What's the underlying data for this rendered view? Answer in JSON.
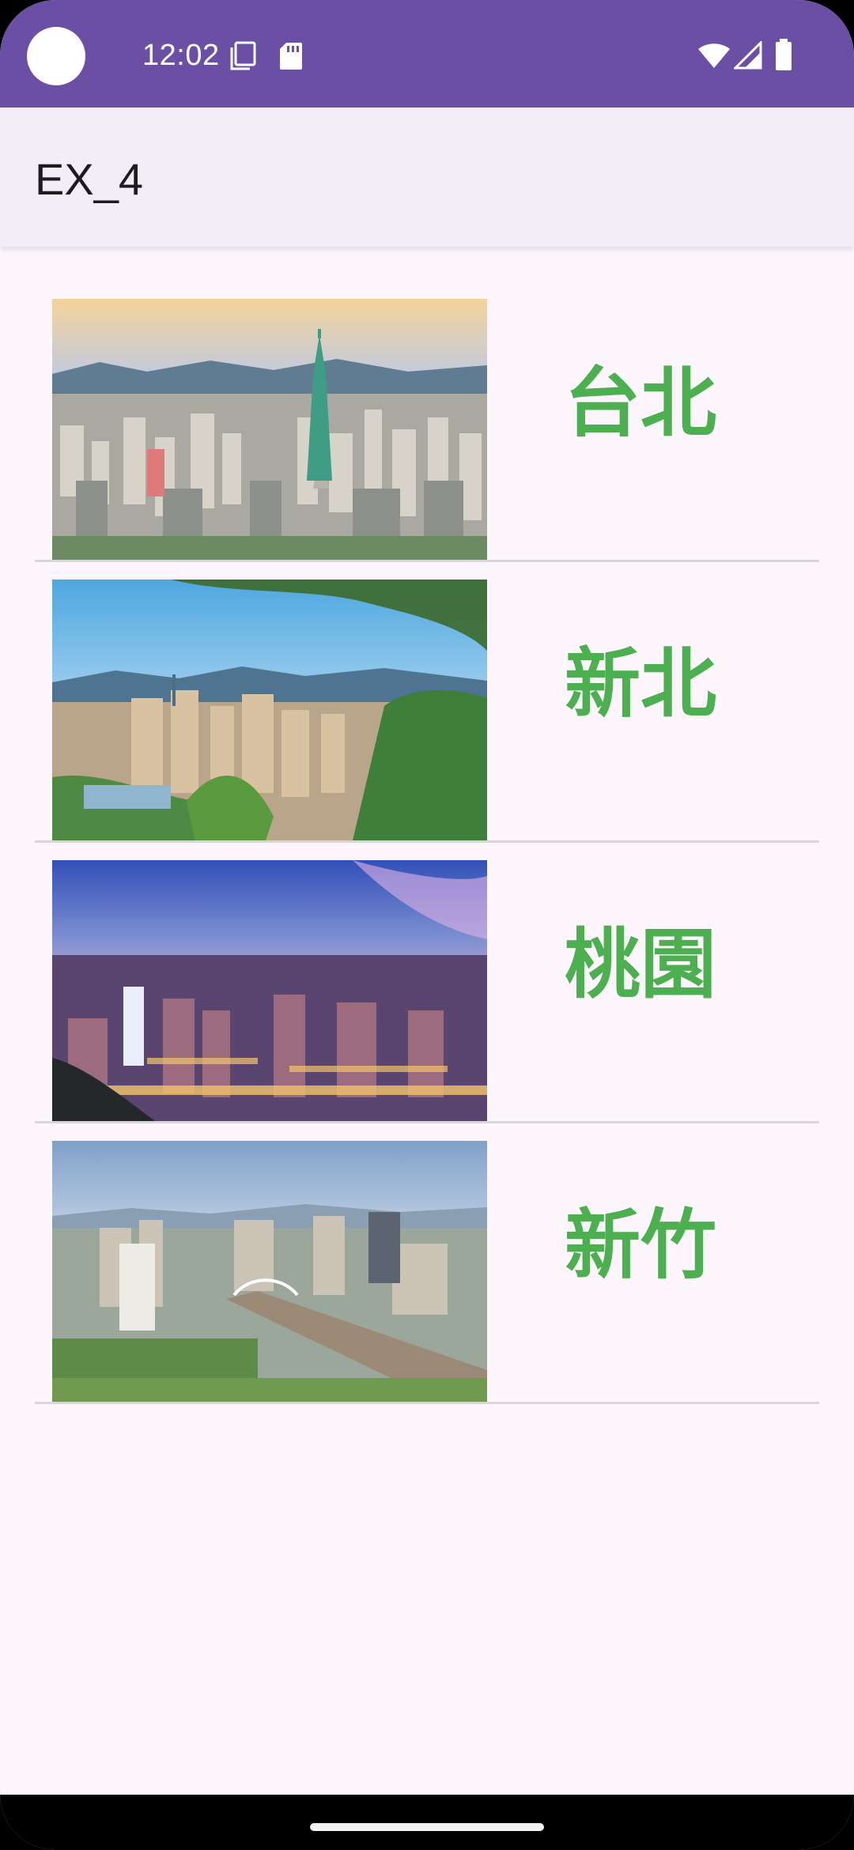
{
  "status_bar": {
    "time": "12:02",
    "icons": [
      "screenshot-icon",
      "sd-card-icon",
      "wifi-icon",
      "signal-icon",
      "battery-icon"
    ]
  },
  "app_bar": {
    "title": "EX_4"
  },
  "cities": [
    {
      "name": "台北",
      "image": "taipei-skyline-image"
    },
    {
      "name": "新北",
      "image": "new-taipei-skyline-image"
    },
    {
      "name": "桃園",
      "image": "taoyuan-night-skyline-image"
    },
    {
      "name": "新竹",
      "image": "hsinchu-skyline-image"
    }
  ],
  "colors": {
    "status_bar": "#6a4fa4",
    "app_bar": "#f2edf7",
    "background": "#fdf7fd",
    "city_text": "#4caf50"
  }
}
